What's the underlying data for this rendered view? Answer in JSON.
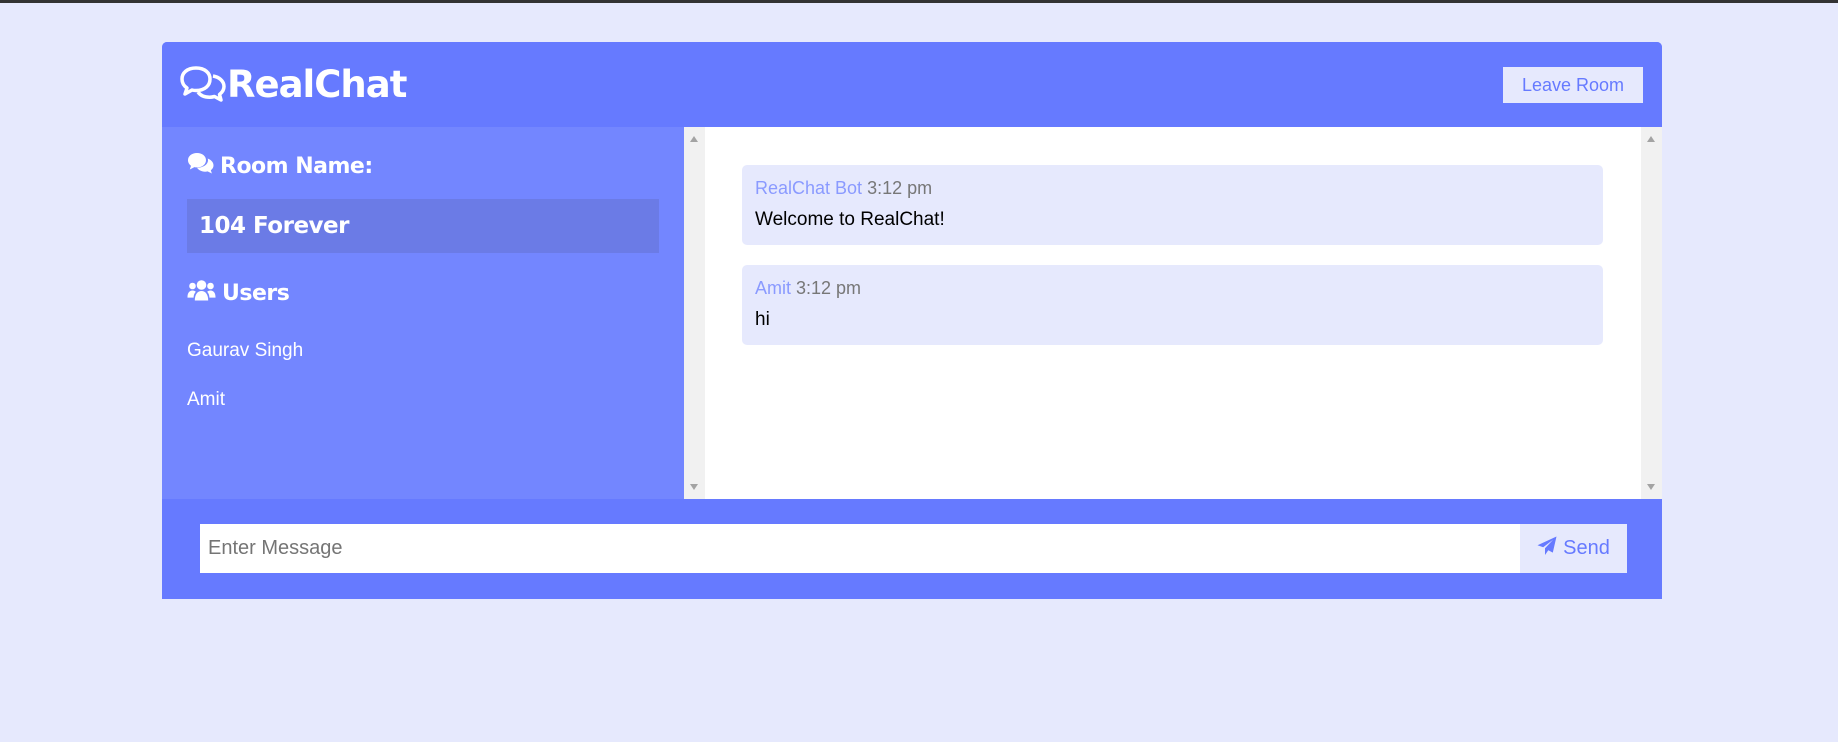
{
  "colors": {
    "page_background": "#e6e9fd",
    "primary": "#667aff",
    "sidebar": "#7386ff",
    "room_box": "#6b7be6",
    "message_bubble": "#e6e9fd",
    "author": "#8a9aff"
  },
  "header": {
    "logo_icon": "comments-outline-icon",
    "title": "RealChat",
    "leave_label": "Leave Room"
  },
  "sidebar": {
    "room_heading_icon": "comments-icon",
    "room_heading": "Room Name:",
    "room_name": "104 Forever",
    "users_heading_icon": "users-icon",
    "users_heading": "Users",
    "users": [
      "Gaurav Singh",
      "Amit"
    ]
  },
  "messages": [
    {
      "author": "RealChat Bot",
      "time": "3:12 pm",
      "text": "Welcome to RealChat!"
    },
    {
      "author": "Amit",
      "time": "3:12 pm",
      "text": "hi"
    }
  ],
  "composer": {
    "placeholder": "Enter Message",
    "value": "",
    "send_icon": "paper-plane-icon",
    "send_label": "Send"
  }
}
